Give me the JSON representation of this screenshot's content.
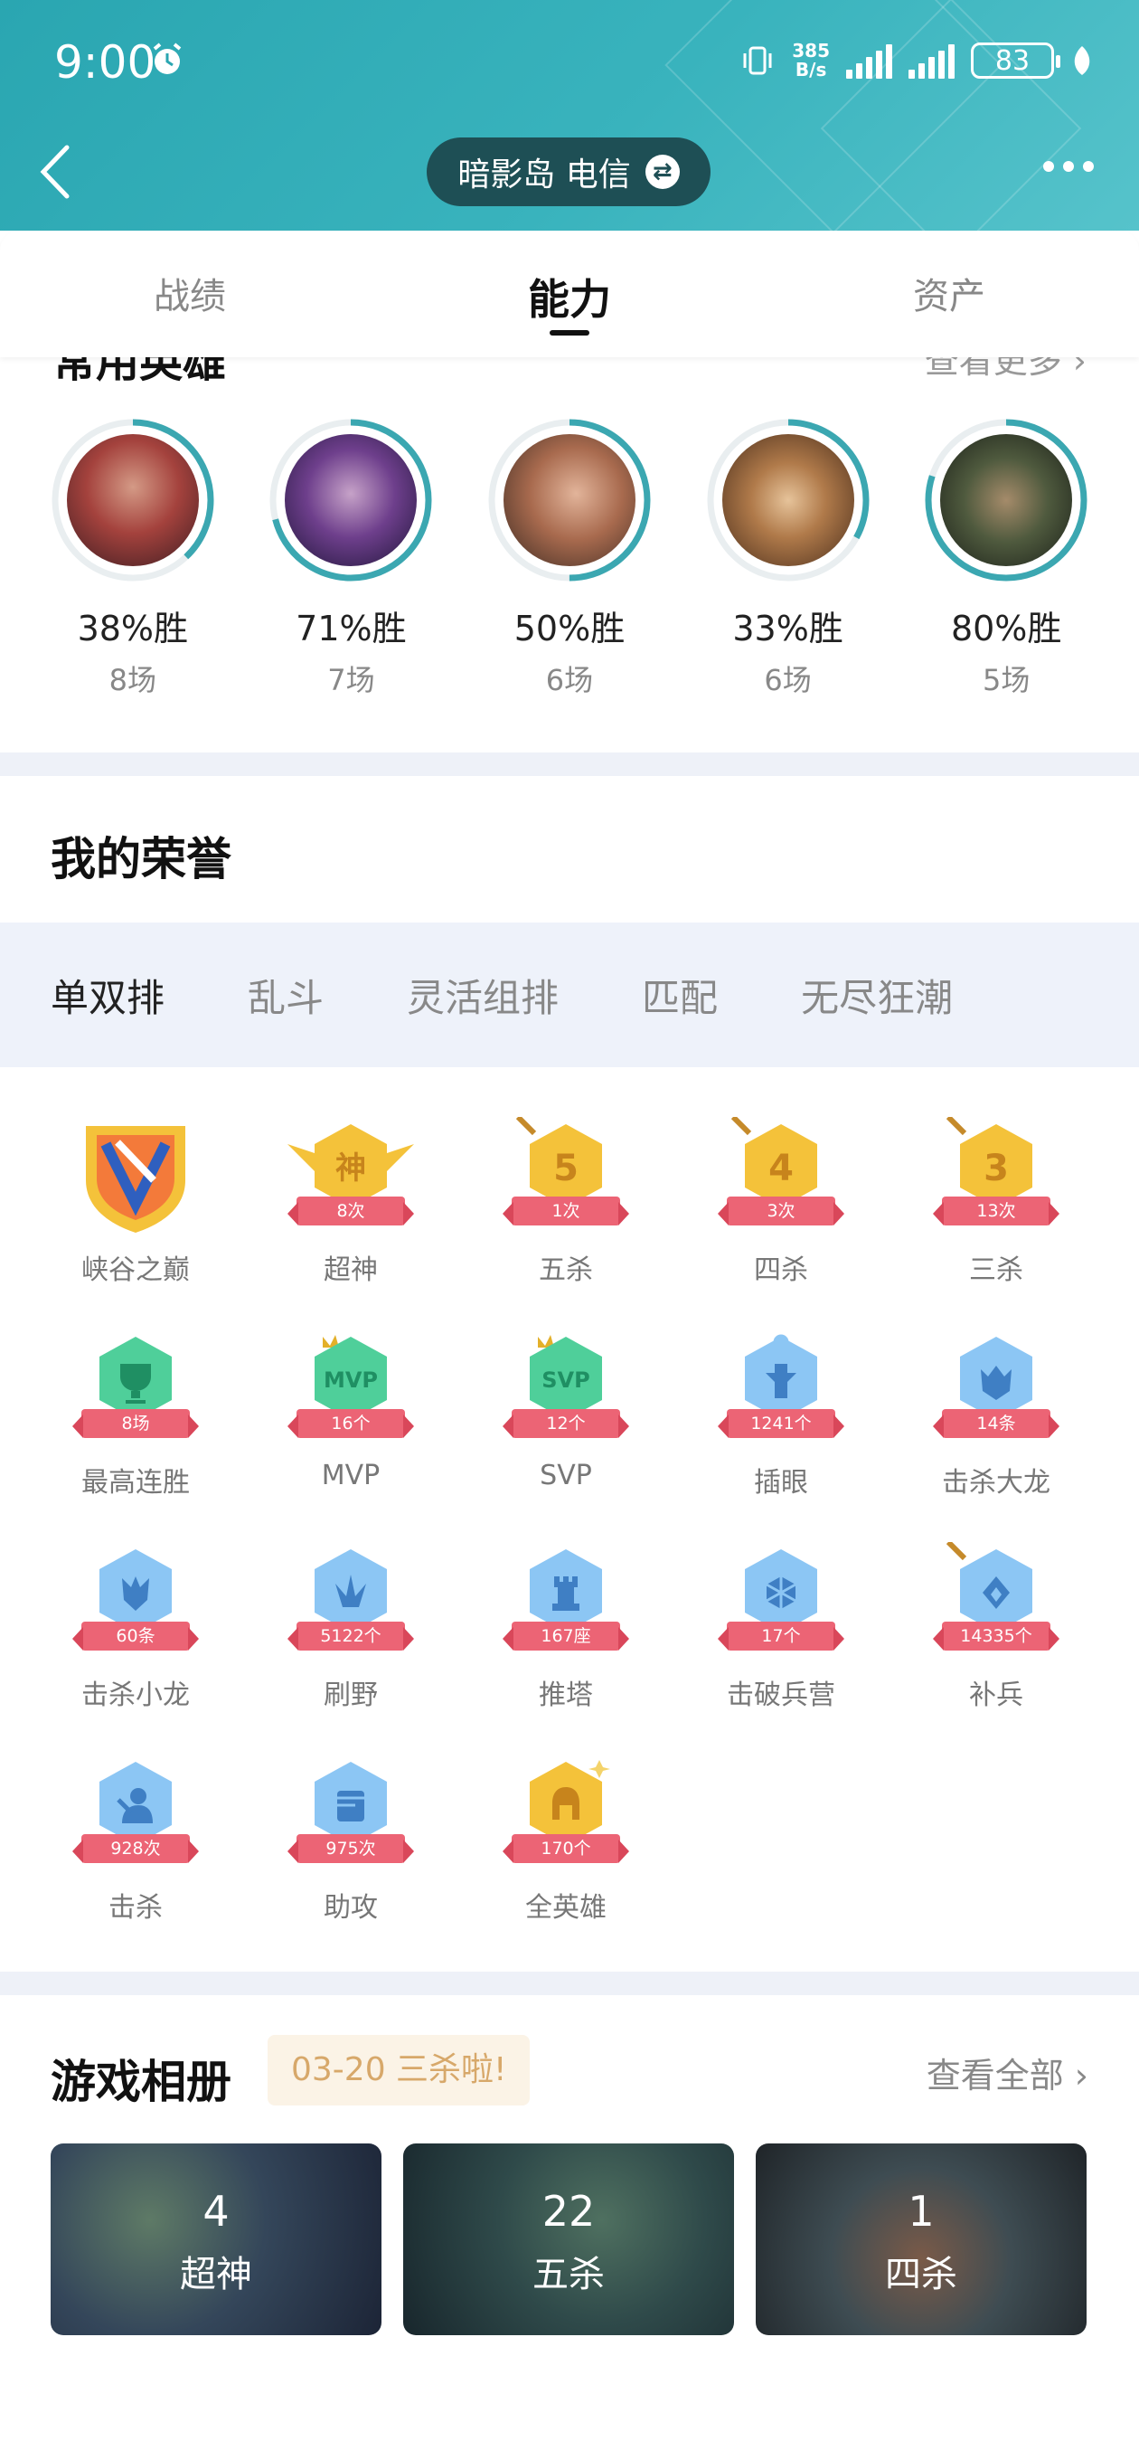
{
  "status_bar": {
    "time": "9:00",
    "speed_value": "385",
    "speed_unit": "B/s",
    "battery": "83"
  },
  "header": {
    "server": "暗影岛 电信"
  },
  "tabs": [
    {
      "label": "战绩",
      "active": false
    },
    {
      "label": "能力",
      "active": true
    },
    {
      "label": "资产",
      "active": false
    }
  ],
  "common_heroes": {
    "title": "常用英雄",
    "more": "查看更多",
    "items": [
      {
        "win_rate": "38%胜",
        "games": "8场",
        "rate": 0.38
      },
      {
        "win_rate": "71%胜",
        "games": "7场",
        "rate": 0.71
      },
      {
        "win_rate": "50%胜",
        "games": "6场",
        "rate": 0.5
      },
      {
        "win_rate": "33%胜",
        "games": "6场",
        "rate": 0.33
      },
      {
        "win_rate": "80%胜",
        "games": "5场",
        "rate": 0.8
      }
    ]
  },
  "honors": {
    "title": "我的荣誉",
    "modes": [
      "单双排",
      "乱斗",
      "灵活组排",
      "匹配",
      "无尽狂潮"
    ],
    "active_mode": "单双排",
    "items": [
      {
        "name": "峡谷之巅",
        "count": "",
        "icon": "summit-shield-icon"
      },
      {
        "name": "超神",
        "count": "8次",
        "icon": "legendary-icon",
        "glyph": "神"
      },
      {
        "name": "五杀",
        "count": "1次",
        "icon": "pentakill-icon",
        "glyph": "5"
      },
      {
        "name": "四杀",
        "count": "3次",
        "icon": "quadrakill-icon",
        "glyph": "4"
      },
      {
        "name": "三杀",
        "count": "13次",
        "icon": "triplekill-icon",
        "glyph": "3"
      },
      {
        "name": "最高连胜",
        "count": "8场",
        "icon": "trophy-icon",
        "glyph": "🏆"
      },
      {
        "name": "MVP",
        "count": "16个",
        "icon": "mvp-icon",
        "glyph": "MVP"
      },
      {
        "name": "SVP",
        "count": "12个",
        "icon": "svp-icon",
        "glyph": "SVP"
      },
      {
        "name": "插眼",
        "count": "1241个",
        "icon": "ward-icon",
        "glyph": "♙"
      },
      {
        "name": "击杀大龙",
        "count": "14条",
        "icon": "baron-icon",
        "glyph": "♞"
      },
      {
        "name": "击杀小龙",
        "count": "60条",
        "icon": "dragon-icon",
        "glyph": "♞"
      },
      {
        "name": "刷野",
        "count": "5122个",
        "icon": "jungle-icon",
        "glyph": "♣"
      },
      {
        "name": "推塔",
        "count": "167座",
        "icon": "tower-icon",
        "glyph": "♜"
      },
      {
        "name": "击破兵营",
        "count": "17个",
        "icon": "inhibitor-icon",
        "glyph": "✲"
      },
      {
        "name": "补兵",
        "count": "14335个",
        "icon": "minion-icon",
        "glyph": "◆"
      },
      {
        "name": "击杀",
        "count": "928次",
        "icon": "kill-icon",
        "glyph": "✖"
      },
      {
        "name": "助攻",
        "count": "975次",
        "icon": "assist-icon",
        "glyph": "✊"
      },
      {
        "name": "全英雄",
        "count": "170个",
        "icon": "all-heroes-icon",
        "glyph": "⛑"
      }
    ]
  },
  "album": {
    "title": "游戏相册",
    "tip": "03-20 三杀啦!",
    "view_all": "查看全部",
    "cards": [
      {
        "count": "4",
        "label": "超神"
      },
      {
        "count": "22",
        "label": "五杀"
      },
      {
        "count": "1",
        "label": "四杀"
      }
    ]
  },
  "colors": {
    "header": "#2aa6b1",
    "ring": "#3ba7b1",
    "badge_gold": "#f4c23a",
    "badge_green": "#4fcf9a",
    "badge_blue": "#8cc6f4",
    "ribbon": "#ec6475"
  }
}
